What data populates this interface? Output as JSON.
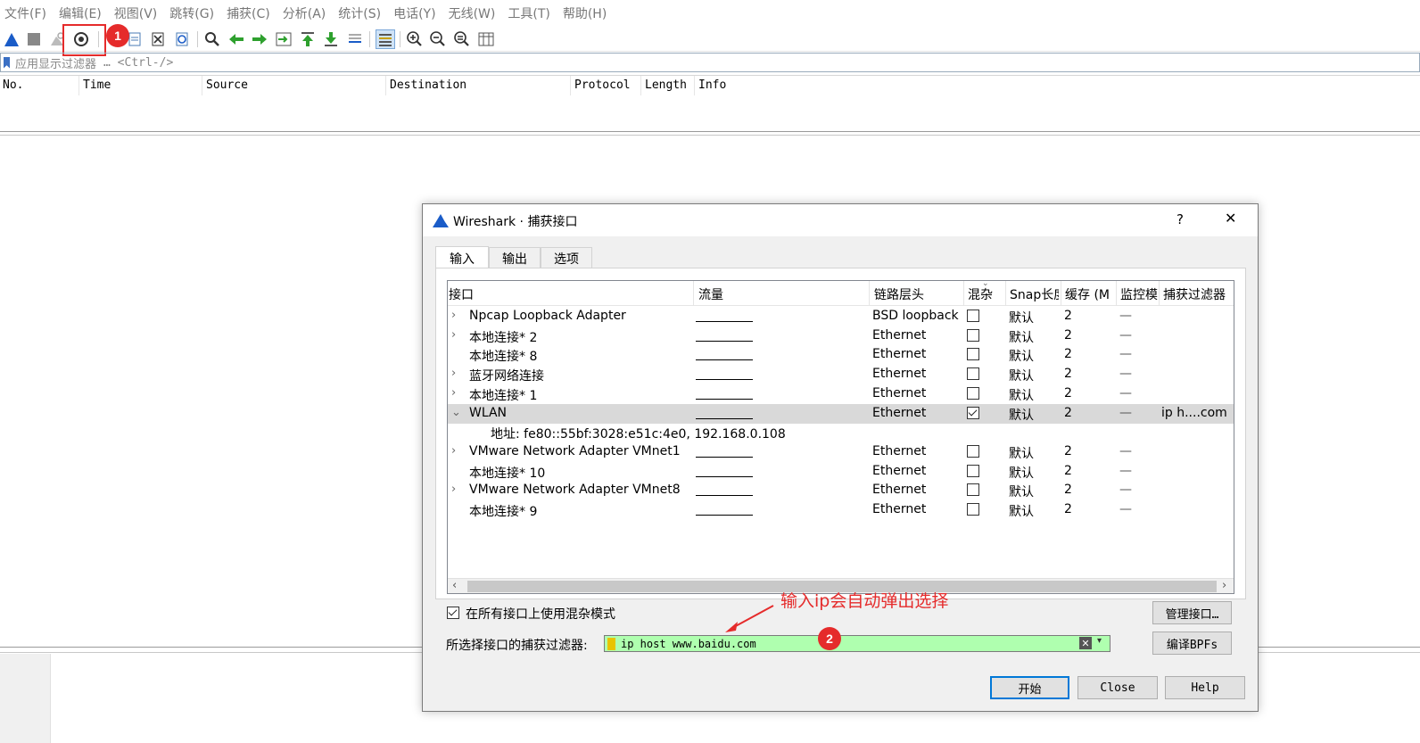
{
  "menu": [
    "文件(F)",
    "编辑(E)",
    "视图(V)",
    "跳转(G)",
    "捕获(C)",
    "分析(A)",
    "统计(S)",
    "电话(Y)",
    "无线(W)",
    "工具(T)",
    "帮助(H)"
  ],
  "filter_bar": {
    "label": "应用显示过滤器",
    "hint": "… <Ctrl-/>"
  },
  "packet_list": {
    "columns": [
      "No.",
      "Time",
      "Source",
      "Destination",
      "Protocol",
      "Length",
      "Info"
    ]
  },
  "dialog": {
    "title": "Wireshark · 捕获接口",
    "help": "?",
    "close": "✕",
    "tabs": [
      "输入",
      "输出",
      "选项"
    ],
    "headers": [
      "接口",
      "流量",
      "链路层头",
      "混杂",
      "Snap长度",
      "缓存 (M",
      "监控模",
      "捕获过滤器"
    ],
    "rows": [
      {
        "expand": "›",
        "name": "Npcap Loopback Adapter",
        "link": "BSD loopback",
        "promisc": false,
        "snap": "默认",
        "buffer": "2",
        "monitor": "—",
        "filter": ""
      },
      {
        "expand": "›",
        "name": "本地连接* 2",
        "link": "Ethernet",
        "promisc": false,
        "snap": "默认",
        "buffer": "2",
        "monitor": "—",
        "filter": ""
      },
      {
        "expand": "",
        "name": "本地连接* 8",
        "link": "Ethernet",
        "promisc": false,
        "snap": "默认",
        "buffer": "2",
        "monitor": "—",
        "filter": ""
      },
      {
        "expand": "›",
        "name": "蓝牙网络连接",
        "link": "Ethernet",
        "promisc": false,
        "snap": "默认",
        "buffer": "2",
        "monitor": "—",
        "filter": ""
      },
      {
        "expand": "›",
        "name": "本地连接* 1",
        "link": "Ethernet",
        "promisc": false,
        "snap": "默认",
        "buffer": "2",
        "monitor": "—",
        "filter": ""
      },
      {
        "expand": "⌄",
        "name": "WLAN",
        "link": "Ethernet",
        "promisc": true,
        "snap": "默认",
        "buffer": "2",
        "monitor": "—",
        "filter": "ip h....com",
        "selected": true
      },
      {
        "address": "地址: fe80::55bf:3028:e51c:4e0, 192.168.0.108"
      },
      {
        "expand": "›",
        "name": "VMware Network Adapter VMnet1",
        "link": "Ethernet",
        "promisc": false,
        "snap": "默认",
        "buffer": "2",
        "monitor": "—",
        "filter": ""
      },
      {
        "expand": "",
        "name": "本地连接* 10",
        "link": "Ethernet",
        "promisc": false,
        "snap": "默认",
        "buffer": "2",
        "monitor": "—",
        "filter": ""
      },
      {
        "expand": "›",
        "name": "VMware Network Adapter VMnet8",
        "link": "Ethernet",
        "promisc": false,
        "snap": "默认",
        "buffer": "2",
        "monitor": "—",
        "filter": ""
      },
      {
        "expand": "",
        "name": "本地连接* 9",
        "link": "Ethernet",
        "promisc": false,
        "snap": "默认",
        "buffer": "2",
        "monitor": "—",
        "filter": ""
      }
    ],
    "promisc_all_label": "在所有接口上使用混杂模式",
    "promisc_all_checked": true,
    "manage_button": "管理接口…",
    "capture_filter_label": "所选择接口的捕获过滤器:",
    "capture_filter_value": "ip host www.baidu.com",
    "compile_button": "编译BPFs",
    "start_button": "开始",
    "close_button": "Close",
    "help_button": "Help"
  },
  "annotations": {
    "marker1": "1",
    "marker2": "2",
    "callout_text": "输入ip会自动弹出选择",
    "color": "#e52b2b"
  },
  "colors": {
    "filter_ok": "#afffaf",
    "selected_row": "#d9d9d9",
    "primary_border": "#0078d7"
  }
}
